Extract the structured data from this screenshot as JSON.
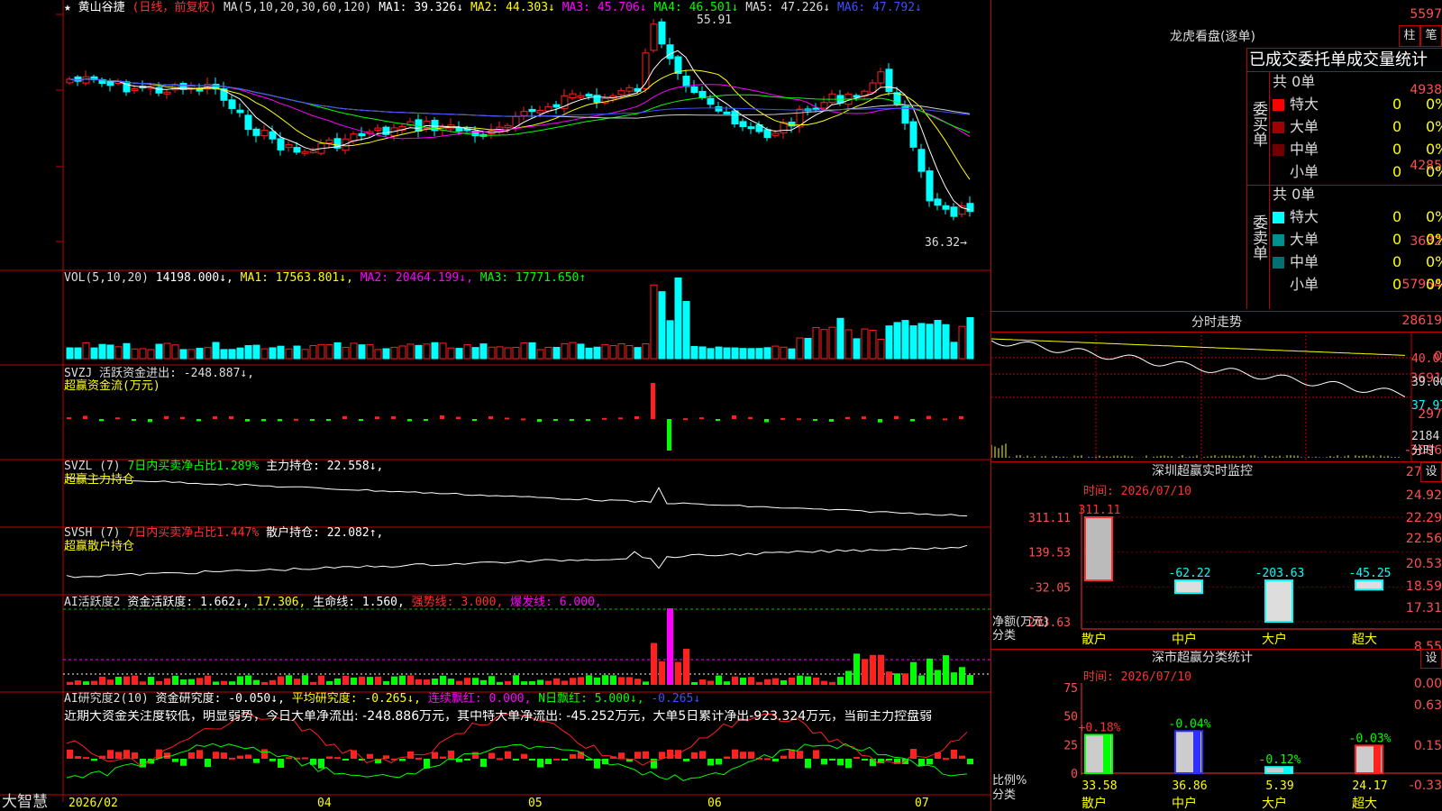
{
  "title_bar": {
    "star": "★",
    "stock_name": "黄山谷捷",
    "period_note": "(日线，前复权)",
    "ma_header": "MA(5,10,20,30,60,120)",
    "ma_items": [
      {
        "label": "MA1: 39.326↓",
        "color": "#ffffff"
      },
      {
        "label": "MA2: 44.303↓",
        "color": "#ffff00"
      },
      {
        "label": "MA3: 45.706↓",
        "color": "#ff00ff"
      },
      {
        "label": "MA4: 46.501↓",
        "color": "#00ff00"
      },
      {
        "label": "MA5: 47.226↓",
        "color": "#dddddd"
      },
      {
        "label": "MA6: 47.792↓",
        "color": "#3f4fff"
      }
    ]
  },
  "price_panel": {
    "y_ticks": [
      "5597",
      "4938",
      "4285",
      "3632"
    ],
    "high_label": "55.91",
    "low_label": "36.32→"
  },
  "vol_panel": {
    "header": "VOL(5,10,20)",
    "items": [
      {
        "label": "14198.000↓,",
        "color": "#ffffff"
      },
      {
        "label": "MA1: 17563.801↓,",
        "color": "#ffff00"
      },
      {
        "label": "MA2: 20464.199↓,",
        "color": "#ff00ff"
      },
      {
        "label": "MA3: 17771.650↑",
        "color": "#00ff00"
      }
    ],
    "y_ticks": [
      "57954",
      "28619",
      "0"
    ]
  },
  "svzj_panel": {
    "line1": "SVZJ  活跃资金进出: -248.887↓,",
    "line2": "超赢资金流(万元)",
    "y_ticks": [
      "3691",
      "297",
      "-3096"
    ]
  },
  "svzl_panel": {
    "name": "SVZL (7)",
    "ratio": "7日内买卖净占比1.289%",
    "hold": "主力持仓: 22.558↓,",
    "line2": "超赢主力持仓",
    "y_ticks": [
      "27.55",
      "24.92",
      "22.29"
    ]
  },
  "svsh_panel": {
    "name": "SVSH (7)",
    "ratio": "7日内买卖净占比1.447%",
    "hold": "散户持仓: 22.082↑,",
    "line2": "超赢散户持仓",
    "y_ticks": [
      "22.56",
      "20.53",
      "18.59"
    ]
  },
  "ai_active_panel": {
    "items": [
      {
        "label": "AI活跃度2",
        "color": "#dddddd"
      },
      {
        "label": "资金活跃度: 1.662↓,",
        "color": "#ffffff"
      },
      {
        "label": "17.306,",
        "color": "#ffff00"
      },
      {
        "label": "生命线: 1.560,",
        "color": "#ffffff"
      },
      {
        "label": "强势线: 3.000,",
        "color": "#ff3030"
      },
      {
        "label": "爆发线: 6.000,",
        "color": "#ff00ff"
      }
    ],
    "y_ticks": [
      "17.31",
      "8.55",
      "0.00"
    ]
  },
  "ai_research_panel": {
    "items": [
      {
        "label": "AI研究度2(10)",
        "color": "#dddddd"
      },
      {
        "label": "资金研究度: -0.050↓,",
        "color": "#ffffff"
      },
      {
        "label": "平均研究度: -0.265↓,",
        "color": "#ffff00"
      },
      {
        "label": "连续飘红: 0.000,",
        "color": "#ff00ff"
      },
      {
        "label": "N日飘红: 5.000↓,",
        "color": "#00ff00"
      },
      {
        "label": "-0.265↓",
        "color": "#3f4fff"
      }
    ],
    "comment": "近期大资金关注度较低，明显弱势，今日大单净流出: -248.886万元，其中特大单净流出: -45.252万元，大单5日累计净出-923.324万元，当前主力控盘弱",
    "y_ticks": [
      "0.63",
      "0.15",
      "-0.33"
    ]
  },
  "bottom_bar": {
    "brand": "大智慧",
    "dates": [
      "2026/02",
      "04",
      "05",
      "06",
      "07"
    ]
  },
  "dragon_tiger": {
    "title": "龙虎看盘(逐单)",
    "btn_bar": "柱",
    "btn_pen": "笔",
    "headers": [
      "已成交委托单成交量统计"
    ],
    "buy_label": "委买单",
    "sell_label": "委卖单",
    "buy_total": "共 0单",
    "sell_total": "共 0单",
    "buy_rows": [
      {
        "name": "特大",
        "count": "0",
        "pct": "0%",
        "color": "#ff0000"
      },
      {
        "name": "大单",
        "count": "0",
        "pct": "0%",
        "color": "#a00000"
      },
      {
        "name": "中单",
        "count": "0",
        "pct": "0%",
        "color": "#700000"
      },
      {
        "name": "小单",
        "count": "0",
        "pct": "0%",
        "color": ""
      }
    ],
    "sell_rows": [
      {
        "name": "特大",
        "count": "0",
        "pct": "0%",
        "color": "#00ffff"
      },
      {
        "name": "大单",
        "count": "0",
        "pct": "0%",
        "color": "#009090"
      },
      {
        "name": "中单",
        "count": "0",
        "pct": "0%",
        "color": "#007070"
      },
      {
        "name": "小单",
        "count": "0",
        "pct": "0%",
        "color": ""
      }
    ]
  },
  "timeshare": {
    "title": "分时走势",
    "y_labels": [
      "40.03",
      "39.00",
      "37.97",
      "2184"
    ],
    "footer": "分时"
  },
  "realtime_monitor": {
    "title": "深圳超赢实时监控",
    "btn": "设",
    "time_label": "时间: 2026/07/10",
    "y_ticks": [
      "311.11",
      "139.53",
      "-32.05",
      "-203.63"
    ],
    "y_unit": "净额(万元)",
    "x_unit": "分类"
  },
  "class_stats": {
    "title": "深市超赢分类统计",
    "btn": "设",
    "time_label": "时间: 2026/07/10",
    "y_ticks": [
      "75",
      "50",
      "25",
      "0"
    ],
    "y_unit": "比例%",
    "x_unit": "分类"
  },
  "chart_data": [
    {
      "type": "bar",
      "title": "深圳超赢实时监控",
      "categories": [
        "散户",
        "中户",
        "大户",
        "超大"
      ],
      "values": [
        311.11,
        -62.22,
        -203.63,
        -45.25
      ],
      "ylabel": "净额(万元)",
      "xlabel": "分类",
      "ylim": [
        -203.63,
        311.11
      ]
    },
    {
      "type": "bar",
      "title": "深市超赢分类统计",
      "categories": [
        "散户",
        "中户",
        "大户",
        "超大"
      ],
      "values": [
        33.58,
        36.86,
        5.39,
        24.17
      ],
      "changes": [
        "+0.18%",
        "-0.04%",
        "-0.12%",
        "-0.03%"
      ],
      "ylabel": "比例%",
      "xlabel": "分类",
      "ylim": [
        0,
        75
      ]
    },
    {
      "type": "line",
      "title": "黄山谷捷 (日线，前复权)",
      "x": [
        "2026/02",
        "04",
        "05",
        "06",
        "07"
      ],
      "ylim": [
        36.32,
        55.91
      ],
      "y_ticks": [
        55.97,
        49.38,
        42.85,
        36.32
      ],
      "series": [
        {
          "name": "MA1",
          "last": 39.326
        },
        {
          "name": "MA2",
          "last": 44.303
        },
        {
          "name": "MA3",
          "last": 45.706
        },
        {
          "name": "MA4",
          "last": 46.501
        },
        {
          "name": "MA5",
          "last": 47.226
        },
        {
          "name": "MA6",
          "last": 47.792
        }
      ],
      "annotations": [
        "55.91",
        "36.32"
      ]
    }
  ]
}
